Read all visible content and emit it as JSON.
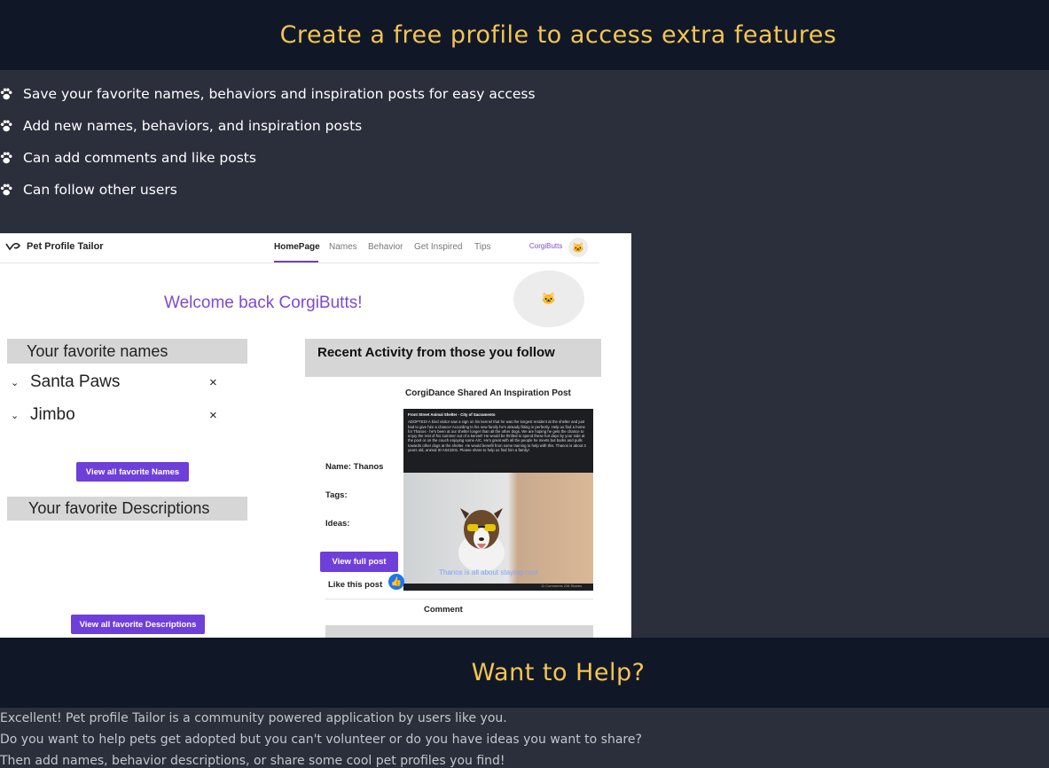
{
  "banner_top": {
    "title": "Create a free profile to access extra features"
  },
  "features": [
    "Save your favorite names, behaviors and inspiration posts for easy access",
    "Add new names, behaviors, and inspiration posts",
    "Can add comments and like posts",
    "Can follow other users"
  ],
  "screenshot": {
    "app_name": "Pet Profile Tailor",
    "nav": [
      "HomePage",
      "Names",
      "Behavior",
      "Get Inspired",
      "Tips"
    ],
    "user": "CorgiButts",
    "welcome": "Welcome back CorgiButts!",
    "fav_names_title": "Your favorite names",
    "fav_names": [
      "Santa Paws",
      "Jimbo"
    ],
    "close_glyph": "×",
    "chevron_glyph": "⌄",
    "view_names_btn": "View all favorite Names",
    "fav_desc_title": "Your favorite Descriptions",
    "view_desc_btn": "View all favorite Descriptions",
    "activity_title": "Recent Activity from those you follow",
    "post_title": "CorgiDance Shared An Inspiration Post",
    "name_label": "Name: Thanos",
    "tags_label": "Tags:",
    "ideas_label": "Ideas:",
    "view_post_btn": "View full post",
    "like_label": "Like this post",
    "comment_label": "Comment",
    "fb_header": "Front Street Animal Shelter - City of Sacramento",
    "fb_text": "ADOPTED! A kind visitor saw a sign on his kennel that he was the longest resident at the shelter and just had to give him a chance! According to his new family he's already fitting in perfectly. Help us find a home for Thanos - he's been at our shelter longer than all the other dogs. We are hoping he gets the chance to enjoy the rest of his summer out of a kennel! He would be thrilled to spend these hot days by your side at the pool or on the couch enjoying some A/C. He's great with all the people he meets but barks and pulls towards other dogs at the shelter. He would benefit from some training to help with this. Thanos is about 3 years old, animal ID A042201. Please share to help us find him a family!",
    "fb_caption": "Thanos is all about staying cool",
    "fb_counts": "11 Comments 228 Shares"
  },
  "banner_bottom": {
    "title": "Want to Help?"
  },
  "help_lines": [
    "Excellent! Pet profile Tailor is a community powered application by users like you.",
    "Do you want to help pets get adopted but you can't volunteer or do you have ideas you want to share?",
    "Then add names, behavior descriptions, or share some cool pet profiles you find!"
  ],
  "colors": {
    "banner_bg": "#101828",
    "page_bg": "#2a2f3b",
    "accent": "#f5c451",
    "purple": "#6f3fd9"
  }
}
